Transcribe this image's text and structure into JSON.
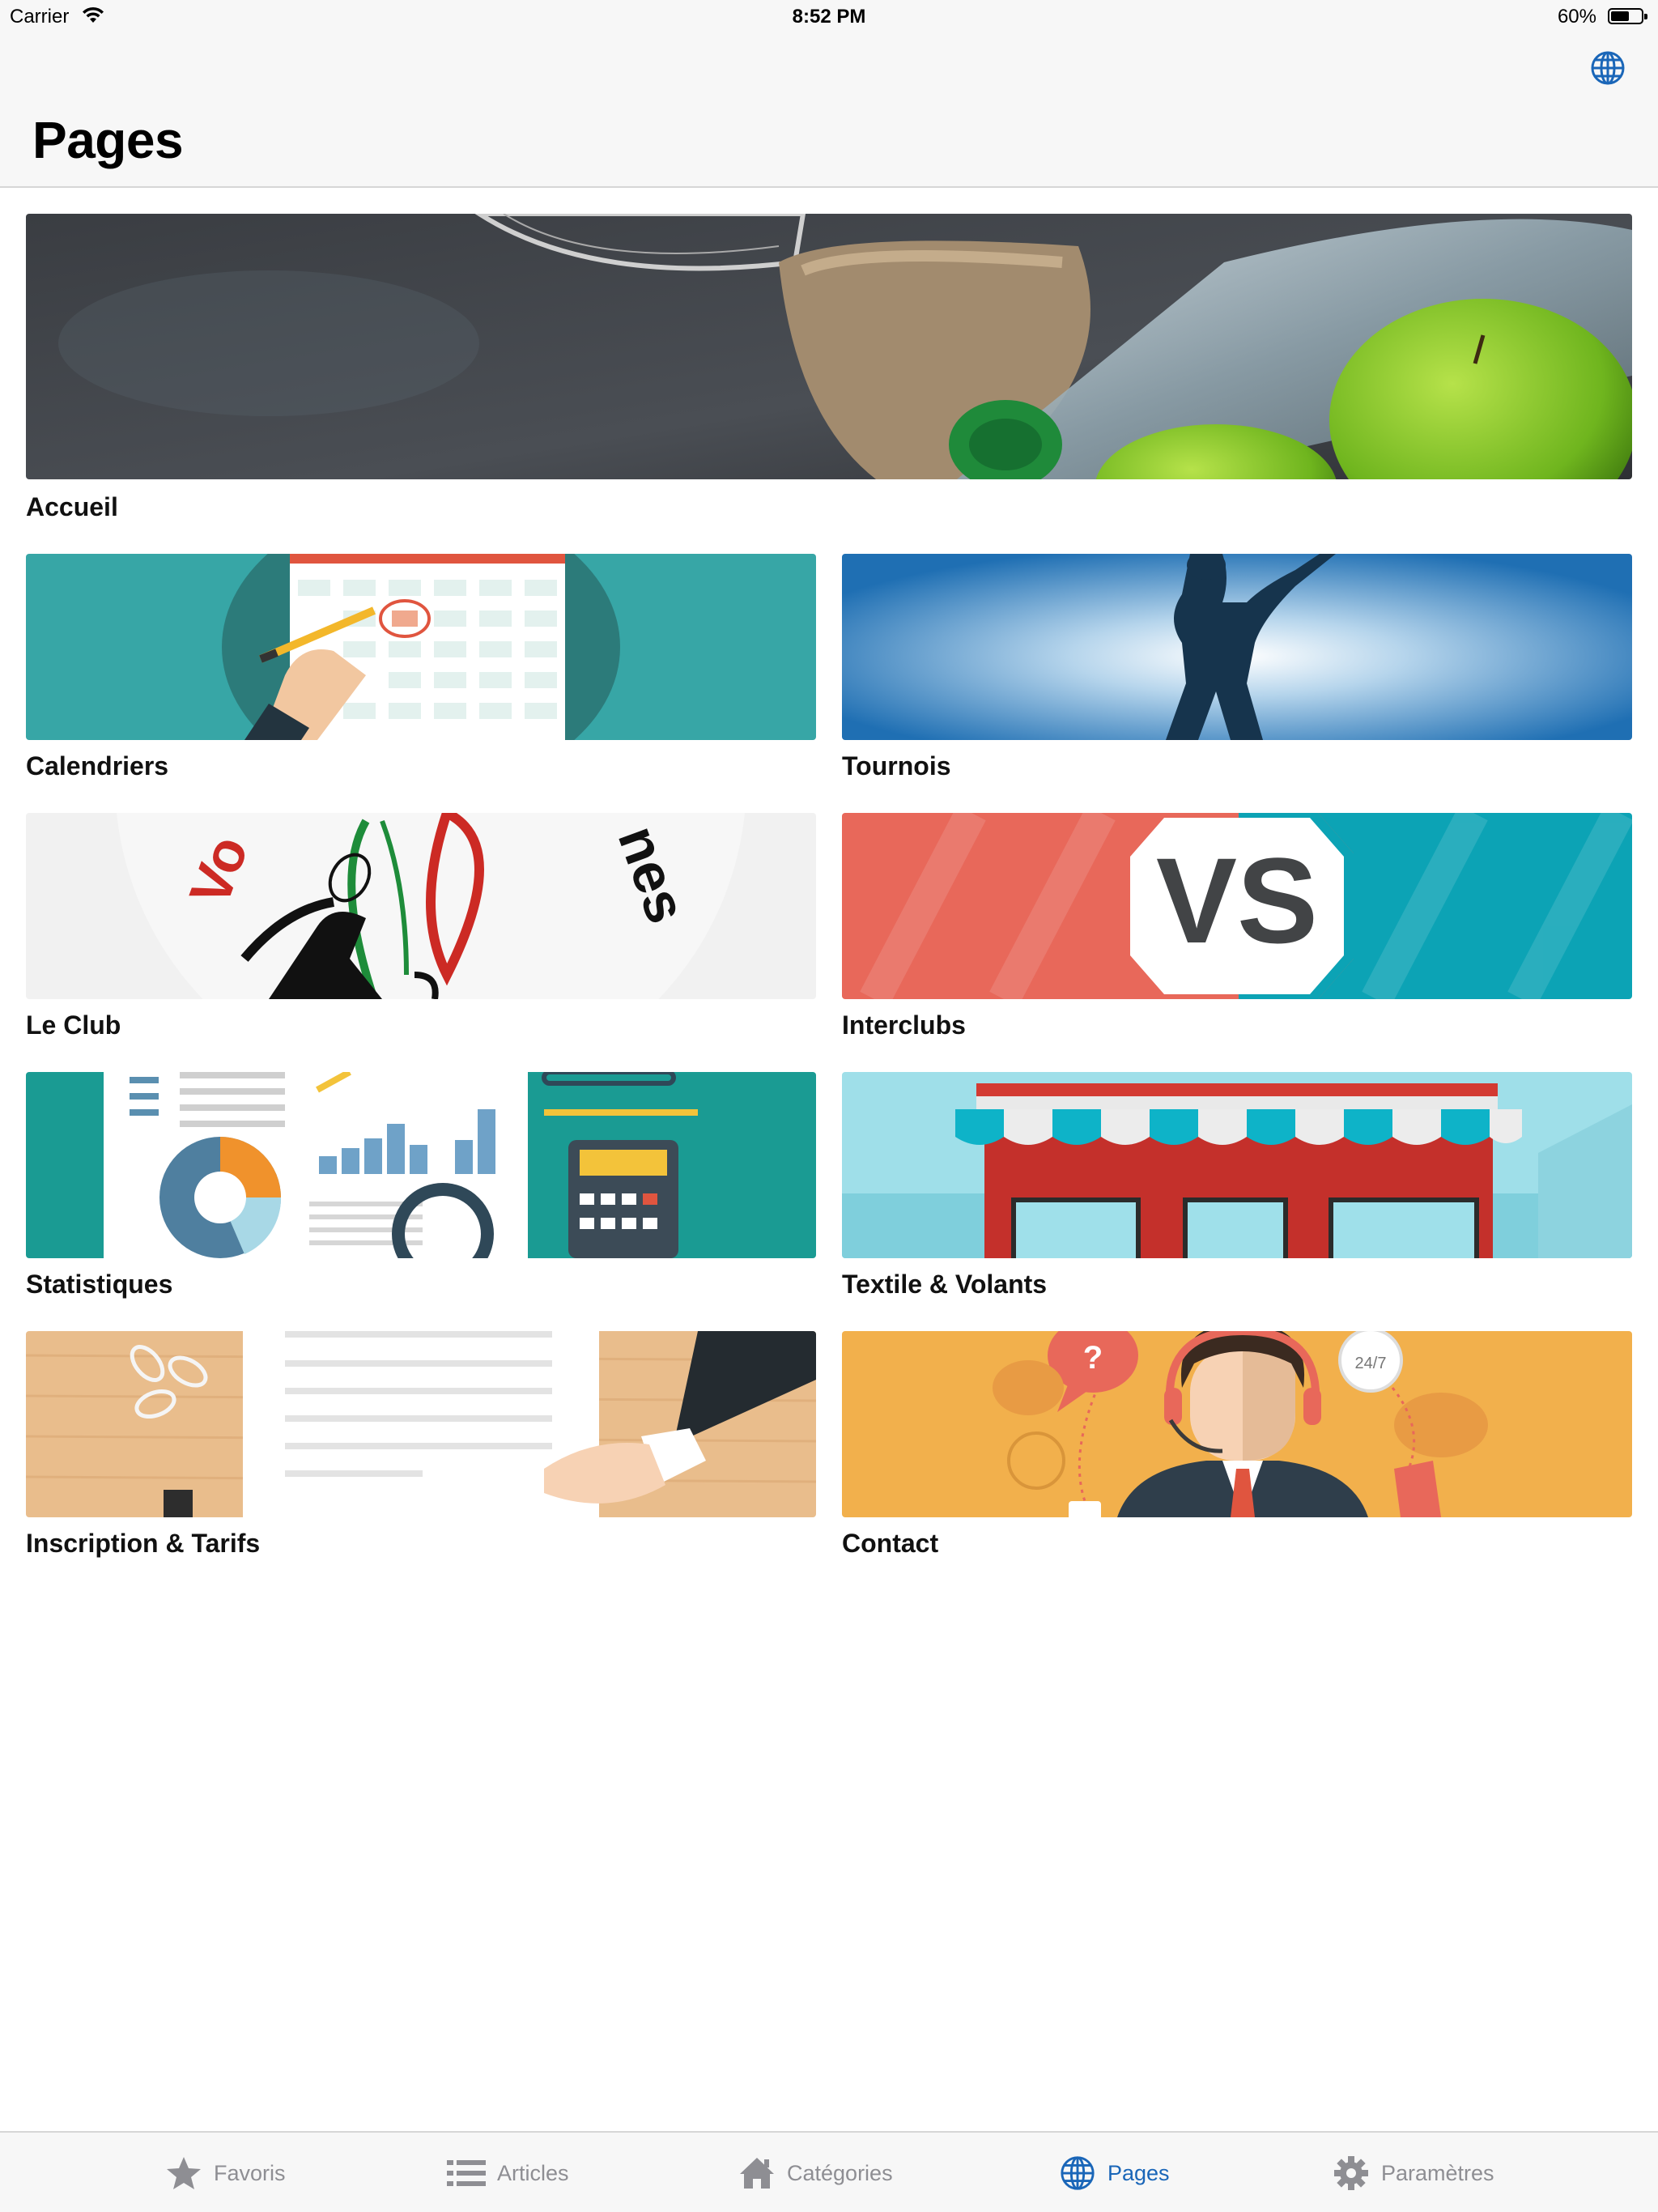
{
  "status_bar": {
    "carrier": "Carrier",
    "time": "8:52 PM",
    "battery": "60%",
    "battery_level": 0.6
  },
  "nav": {
    "title": "Pages",
    "globe_icon": "globe-icon"
  },
  "pages": [
    {
      "label": "Accueil",
      "image": "badminton-racket-towel-bottle-apples"
    },
    {
      "label": "Calendriers",
      "image": "calendar-hand-pencil"
    },
    {
      "label": "Tournois",
      "image": "player-silhouette"
    },
    {
      "label": "Le Club",
      "image": "club-logo"
    },
    {
      "label": "Interclubs",
      "image": "vs-banner"
    },
    {
      "label": "Statistiques",
      "image": "stats-charts-calculator"
    },
    {
      "label": "Textile & Volants",
      "image": "shop-front"
    },
    {
      "label": "Inscription & Tarifs",
      "image": "signing-document"
    },
    {
      "label": "Contact",
      "image": "support-agent"
    }
  ],
  "tabbar": {
    "items": [
      {
        "label": "Favoris",
        "icon": "star-icon",
        "active": false
      },
      {
        "label": "Articles",
        "icon": "list-icon",
        "active": false
      },
      {
        "label": "Catégories",
        "icon": "home-icon",
        "active": false
      },
      {
        "label": "Pages",
        "icon": "globe-icon",
        "active": true
      },
      {
        "label": "Paramètres",
        "icon": "gear-icon",
        "active": false
      }
    ]
  },
  "colors": {
    "accent": "#1a66b8",
    "inactive": "#8e8e93",
    "teal": "#37a6a6",
    "coral": "#e8685a",
    "orange": "#f2b04c"
  }
}
